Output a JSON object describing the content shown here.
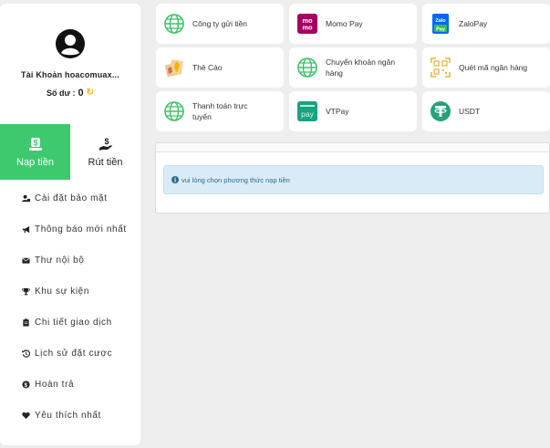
{
  "sidebar": {
    "account_label": "Tài Khoản hoacomuax...",
    "balance_label": "Số dư :",
    "balance_value": "0",
    "tabs": [
      {
        "label": "Nạp tiền",
        "icon": "deposit-icon",
        "active": true
      },
      {
        "label": "Rút tiền",
        "icon": "withdraw-icon",
        "active": false
      }
    ],
    "menu": [
      {
        "label": "Cài đặt bảo mật",
        "icon": "user-lock-icon"
      },
      {
        "label": "Thông báo mới nhất",
        "icon": "bullhorn-icon"
      },
      {
        "label": "Thư nội bộ",
        "icon": "envelope-icon"
      },
      {
        "label": "Khu sự kiện",
        "icon": "trophy-icon"
      },
      {
        "label": "Chi tiết giao dịch",
        "icon": "clipboard-icon"
      },
      {
        "label": "Lịch sử đặt cược",
        "icon": "history-icon"
      },
      {
        "label": "Hoàn trả",
        "icon": "dollar-coin-icon"
      },
      {
        "label": "Yêu thích nhất",
        "icon": "heart-icon"
      }
    ]
  },
  "payments": [
    {
      "label": "Công ty gửi tiền",
      "icon": "globe-icon"
    },
    {
      "label": "Momo Pay",
      "icon": "momo-icon",
      "icon_text_1": "mo",
      "icon_text_2": "mo"
    },
    {
      "label": "ZaloPay",
      "icon": "zalopay-icon",
      "icon_text_1": "Zalo",
      "icon_text_2": "Pay"
    },
    {
      "label": "Thẻ Cào",
      "icon": "scratch-card-icon"
    },
    {
      "label": "Chuyển khoản ngân hàng",
      "icon": "globe-icon"
    },
    {
      "label": "Quét mã ngân hàng",
      "icon": "qr-scan-icon"
    },
    {
      "label": "Thanh toán trực tuyến",
      "icon": "globe-icon"
    },
    {
      "label": "VTPay",
      "icon": "vtpay-icon",
      "icon_text": "pay"
    },
    {
      "label": "USDT",
      "icon": "tether-icon"
    }
  ],
  "notice": {
    "text": "vui lòng chọn phương thức nạp tiền"
  },
  "colors": {
    "accent_green": "#3ec96f",
    "notice_bg": "#d9ebf6",
    "notice_text": "#2e6a8e",
    "globe_green": "#3cc46a",
    "momo": "#a50064",
    "zalo_blue": "#0068ff",
    "vtpay_teal": "#17a37f",
    "tether": "#26a17b",
    "refresh_yellow": "#f5b800"
  }
}
